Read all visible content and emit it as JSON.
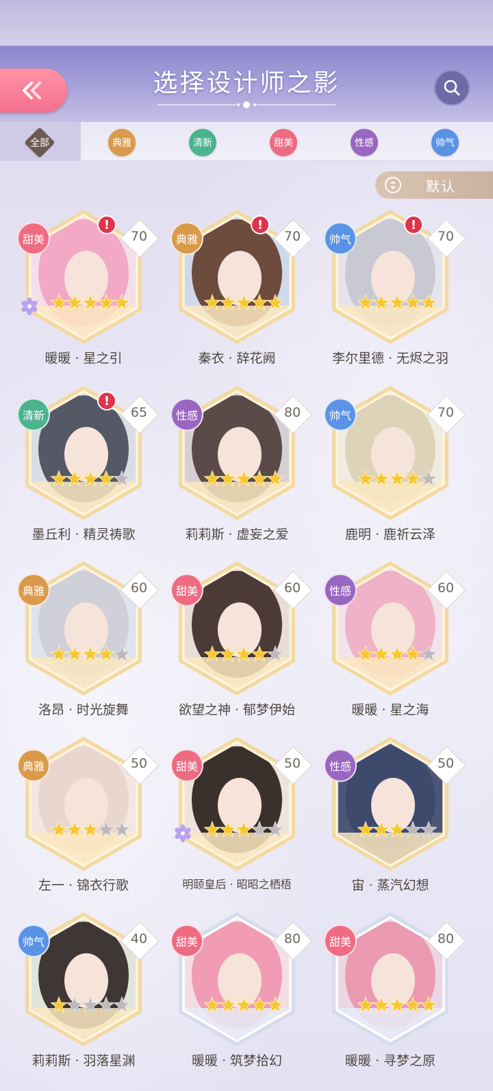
{
  "header": {
    "title": "选择设计师之影",
    "back_icon": "double-chevron-left-icon",
    "search_icon": "search-icon"
  },
  "tabs": [
    {
      "label": "全部",
      "color": "#6a5a52",
      "selected": true
    },
    {
      "label": "典雅",
      "color": "#d99a4c"
    },
    {
      "label": "清新",
      "color": "#4bb38e"
    },
    {
      "label": "甜美",
      "color": "#ee6b82"
    },
    {
      "label": "性感",
      "color": "#9966c0"
    },
    {
      "label": "帅气",
      "color": "#5a93e6"
    }
  ],
  "sort": {
    "label": "默认",
    "icon": "sort-icon"
  },
  "style_colors": {
    "甜美": "#ee6b82",
    "典雅": "#d99a4c",
    "帅气": "#5a93e6",
    "清新": "#4bb38e",
    "性感": "#9966c0"
  },
  "cards": [
    {
      "name": "暖暖 · 星之引",
      "style": "甜美",
      "level": "70",
      "stars": 5,
      "filled": 5,
      "alert": true,
      "flower": true,
      "hair": "#f3a9c6",
      "bg": "#f3dfea",
      "frame": "gold"
    },
    {
      "name": "秦衣 · 辞花阙",
      "style": "典雅",
      "level": "70",
      "stars": 5,
      "filled": 5,
      "alert": true,
      "flower": false,
      "hair": "#6d4b3d",
      "bg": "#cfd9ec",
      "frame": "gold"
    },
    {
      "name": "李尔里德 · 无烬之羽",
      "style": "帅气",
      "level": "70",
      "stars": 5,
      "filled": 5,
      "alert": true,
      "flower": false,
      "hair": "#c9c9d4",
      "bg": "#e4e4ea",
      "frame": "gold"
    },
    {
      "name": "墨丘利 · 精灵祷歌",
      "style": "清新",
      "level": "65",
      "stars": 5,
      "filled": 4,
      "alert": true,
      "flower": false,
      "hair": "#555965",
      "bg": "#d9dee6",
      "frame": "gold"
    },
    {
      "name": "莉莉斯 · 虚妄之爱",
      "style": "性感",
      "level": "80",
      "stars": 5,
      "filled": 5,
      "alert": false,
      "flower": false,
      "hair": "#5a4a48",
      "bg": "#d7cfd3",
      "frame": "gold"
    },
    {
      "name": "鹿明 · 鹿祈云泽",
      "style": "帅气",
      "level": "70",
      "stars": 5,
      "filled": 4,
      "alert": false,
      "flower": false,
      "hair": "#dcd3b9",
      "bg": "#f0ece0",
      "frame": "gold"
    },
    {
      "name": "洛昂 · 时光旋舞",
      "style": "典雅",
      "level": "60",
      "stars": 5,
      "filled": 4,
      "alert": false,
      "flower": false,
      "hair": "#cfd0d8",
      "bg": "#dfe3ee",
      "frame": "gold"
    },
    {
      "name": "欲望之神 · 郁梦伊始",
      "style": "甜美",
      "level": "60",
      "stars": 5,
      "filled": 4,
      "alert": false,
      "flower": false,
      "hair": "#4c3a36",
      "bg": "#e7ddd6",
      "frame": "gold"
    },
    {
      "name": "暖暖 · 星之海",
      "style": "性感",
      "level": "60",
      "stars": 5,
      "filled": 4,
      "alert": false,
      "flower": false,
      "hair": "#efb2c6",
      "bg": "#f2e2ea",
      "frame": "gold"
    },
    {
      "name": "左一 · 锦衣行歌",
      "style": "典雅",
      "level": "50",
      "stars": 5,
      "filled": 3,
      "alert": false,
      "flower": false,
      "hair": "#e9d7cf",
      "bg": "#f4e6e2",
      "frame": "gold"
    },
    {
      "name": "明颐皇后 · 昭昭之栖梧",
      "style": "甜美",
      "level": "50",
      "stars": 5,
      "filled": 3,
      "alert": false,
      "flower": true,
      "hair": "#3a302c",
      "bg": "#efe4dc",
      "frame": "gold",
      "small": true
    },
    {
      "name": "宙 · 蒸汽幻想",
      "style": "性感",
      "level": "50",
      "stars": 5,
      "filled": 3,
      "alert": false,
      "flower": false,
      "hair": "#3e4a6c",
      "bg": "#4e5675",
      "frame": "gold"
    },
    {
      "name": "莉莉斯 · 羽落星渊",
      "style": "帅气",
      "level": "40",
      "stars": 5,
      "filled": 1,
      "alert": false,
      "flower": false,
      "hair": "#3f3735",
      "bg": "#dfe6d9",
      "frame": "gold"
    },
    {
      "name": "暖暖 · 筑梦拾幻",
      "style": "甜美",
      "level": "80",
      "stars": 5,
      "filled": 5,
      "alert": false,
      "flower": false,
      "hair": "#f19bb4",
      "bg": "#f3dde6",
      "frame": "silver"
    },
    {
      "name": "暖暖 · 寻梦之原",
      "style": "甜美",
      "level": "80",
      "stars": 5,
      "filled": 5,
      "alert": false,
      "flower": false,
      "hair": "#eb9ab1",
      "bg": "#ead6e4",
      "frame": "silver"
    }
  ]
}
